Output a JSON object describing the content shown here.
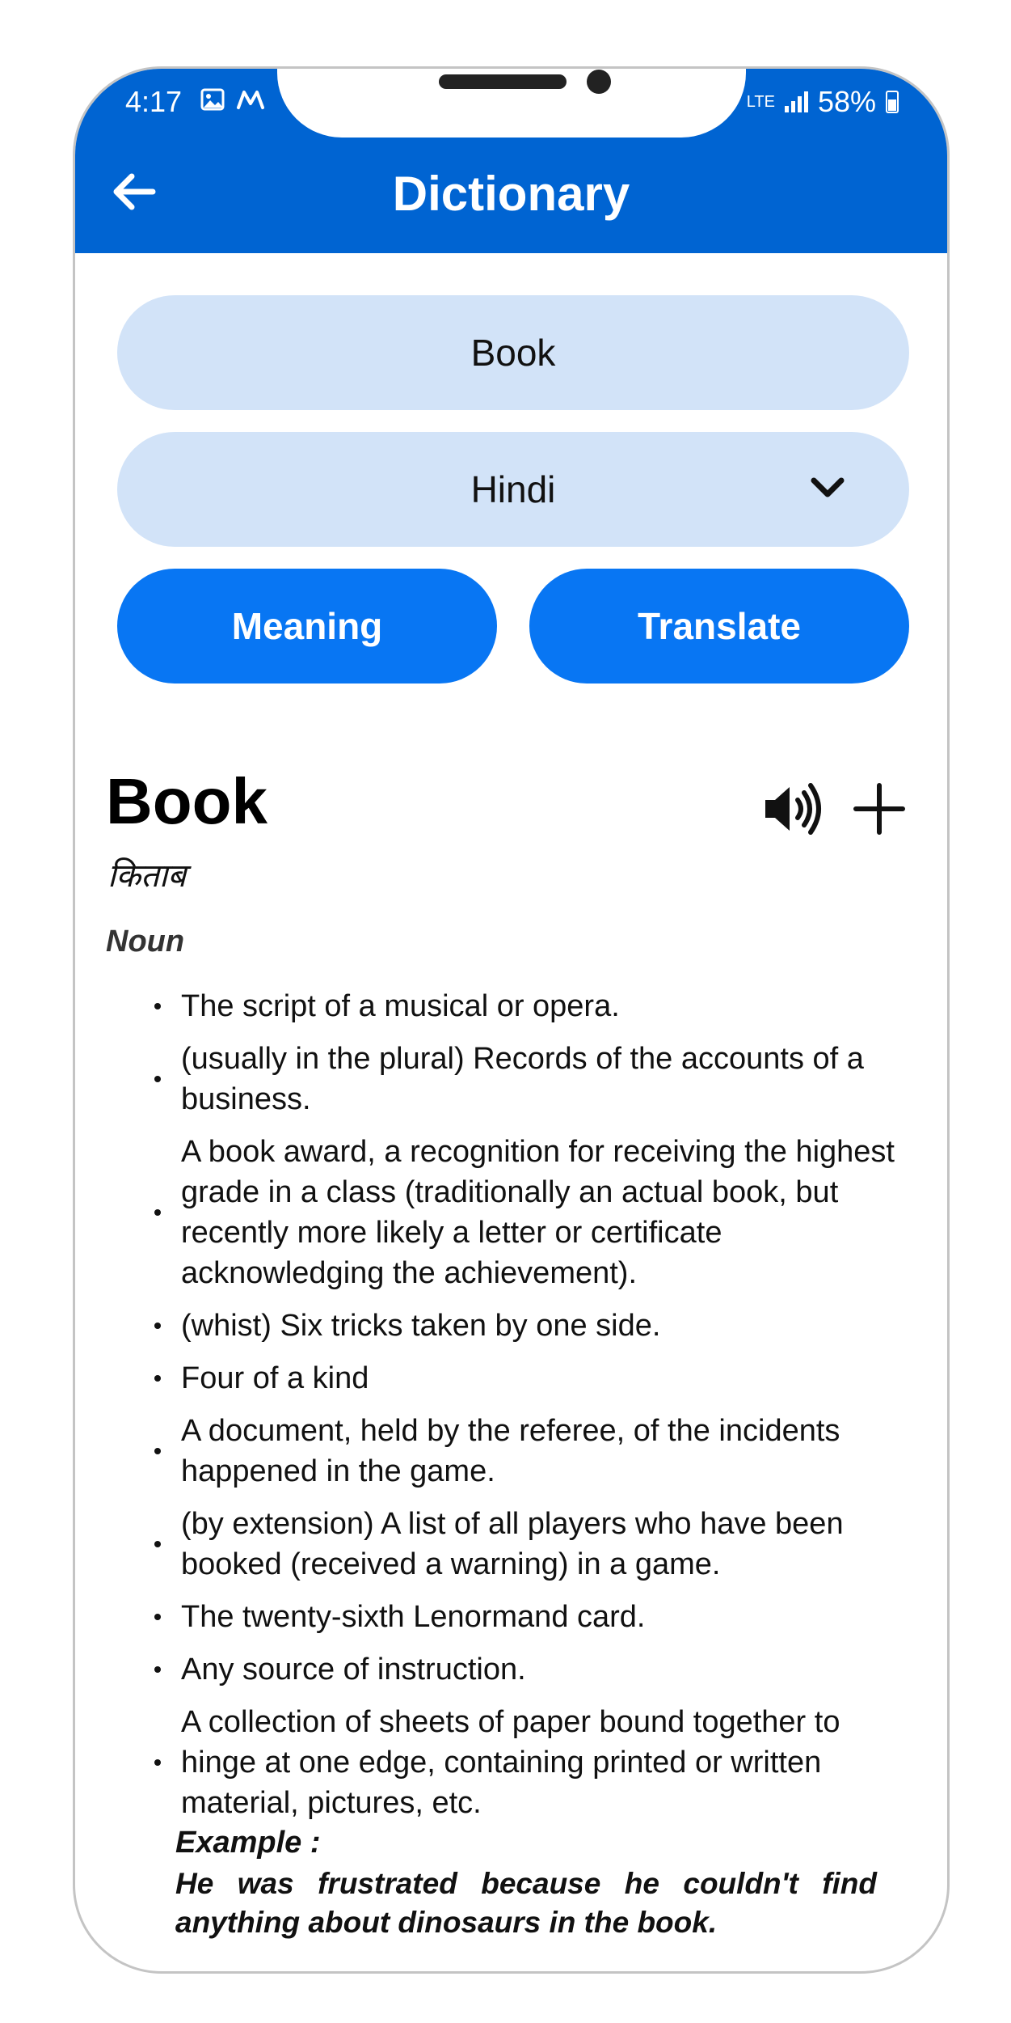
{
  "status_bar": {
    "time": "4:17",
    "left_icons": [
      "image-icon",
      "m-app-icon"
    ],
    "network": "LTE",
    "battery": "58%"
  },
  "app_bar": {
    "title": "Dictionary",
    "back_icon": "arrow-left-icon",
    "color": "#0064d2"
  },
  "search": {
    "value": "Book",
    "placeholder": ""
  },
  "language_select": {
    "selected": "Hindi",
    "icon": "chevron-down-icon"
  },
  "actions": {
    "meaning_label": "Meaning",
    "translate_label": "Translate",
    "accent": "#0876f3"
  },
  "result": {
    "word": "Book",
    "translation": "किताब",
    "part_of_speech": "Noun",
    "speaker_icon": "speaker-icon",
    "add_icon": "plus-icon",
    "definitions": [
      "The script of a musical or opera.",
      "(usually in the plural) Records of the accounts of a business.",
      "A book award, a recognition for receiving the highest grade in a class (traditionally an actual book, but recently more likely a letter or certificate acknowledging the achievement).",
      "(whist) Six tricks taken by one side.",
      "Four of a kind",
      "A document, held by the referee, of the incidents happened in the game.",
      "(by extension) A list of all players who have been booked (received a warning) in a game.",
      "The twenty-sixth Lenormand card.",
      "Any source of instruction.",
      "A collection of sheets of paper bound together to hinge at one edge, containing printed or written material, pictures, etc."
    ],
    "example_label": "Example :",
    "example_text": "He was frustrated because he couldn't find anything about dinosaurs in the book."
  }
}
